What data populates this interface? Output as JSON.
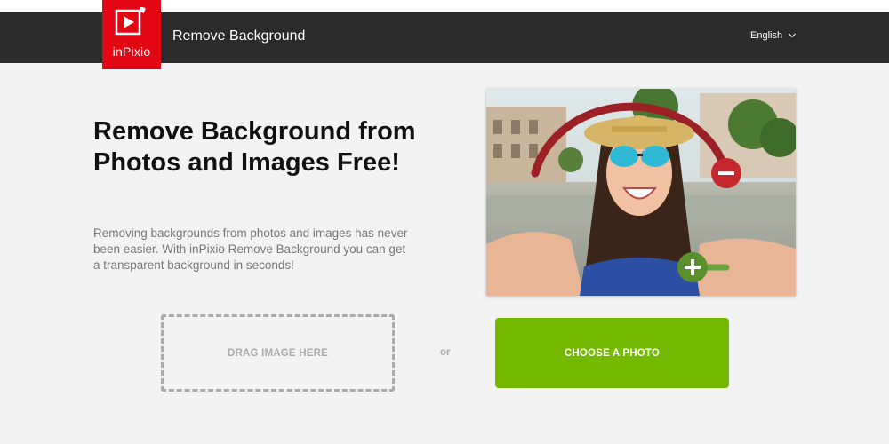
{
  "header": {
    "logo_text": "inPixio",
    "app_title": "Remove Background",
    "language": "English"
  },
  "hero": {
    "title": "Remove Background from Photos and Images Free!",
    "description": "Removing backgrounds from photos and images has never been easier. With inPixio Remove Background you can get a transparent background in seconds!"
  },
  "upload": {
    "drop_label": "DRAG IMAGE HERE",
    "or_label": "or",
    "choose_label": "CHOOSE A PHOTO"
  },
  "colors": {
    "brand_red": "#e30613",
    "header_bg": "#2b2b2b",
    "button_green": "#74b800",
    "page_bg": "#f3f3f3"
  },
  "icons": [
    "play-logo-icon",
    "chevron-down-icon",
    "minus-icon",
    "plus-icon"
  ]
}
